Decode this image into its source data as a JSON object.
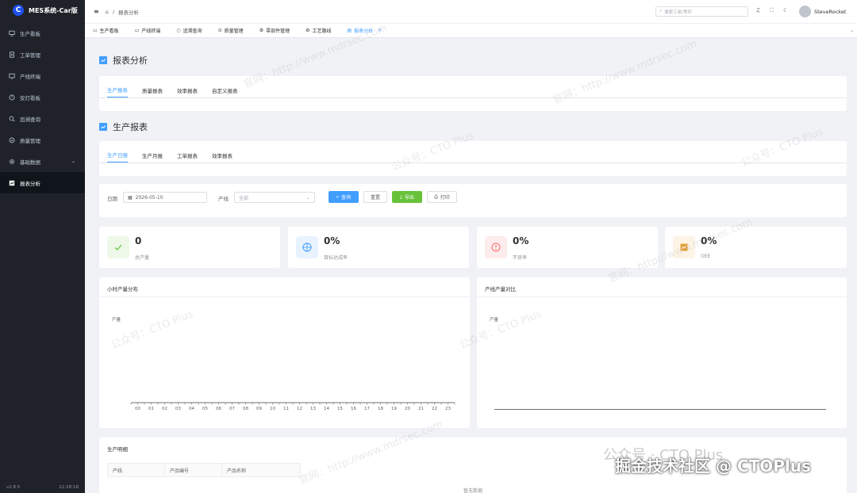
{
  "app": {
    "title": "MES系统-Car版",
    "logo_letter": "C",
    "version": "v2.8.5",
    "clock": "22:28:18"
  },
  "sidebar": {
    "items": [
      {
        "label": "生产看板",
        "icon": "monitor-icon"
      },
      {
        "label": "工单管理",
        "icon": "document-icon"
      },
      {
        "label": "产线终端",
        "icon": "terminal-icon"
      },
      {
        "label": "安灯看板",
        "icon": "alarm-icon"
      },
      {
        "label": "追溯查询",
        "icon": "search-icon"
      },
      {
        "label": "质量管理",
        "icon": "check-circle-icon"
      },
      {
        "label": "基础数据",
        "icon": "gear-icon"
      },
      {
        "label": "报表分析",
        "icon": "chart-icon"
      }
    ]
  },
  "header": {
    "breadcrumb": "报表分析",
    "search_placeholder": "搜索工单/零件",
    "user": "SteveRocket"
  },
  "tabs": [
    {
      "label": "生产看板"
    },
    {
      "label": "产线终端"
    },
    {
      "label": "追溯查询"
    },
    {
      "label": "质量管理"
    },
    {
      "label": "零部件管理"
    },
    {
      "label": "工艺路线"
    },
    {
      "label": "报表分析"
    }
  ],
  "page": {
    "title": "报表分析",
    "report_tabs": [
      "生产报表",
      "质量报表",
      "效率报表",
      "自定义报表"
    ],
    "section_title": "生产报表",
    "sub_tabs": [
      "生产日报",
      "生产月报",
      "工单报表",
      "效率报表"
    ]
  },
  "filters": {
    "date_label": "日期",
    "date_value": "2026-05-10",
    "line_label": "产线",
    "line_placeholder": "全部",
    "query": "查询",
    "reset": "重置",
    "export": "导出",
    "print": "打印"
  },
  "stats": [
    {
      "value": "0",
      "label": "总产量",
      "color": "#67c23a",
      "bg": "#eef8e8"
    },
    {
      "value": "0%",
      "label": "目标达成率",
      "color": "#409eff",
      "bg": "#e8f3ff"
    },
    {
      "value": "0%",
      "label": "不良率",
      "color": "#f56c6c",
      "bg": "#fdecec"
    },
    {
      "value": "0%",
      "label": "OEE",
      "color": "#e6a23c",
      "bg": "#fdf4e6"
    }
  ],
  "charts": {
    "hourly_title": "小时产量分布",
    "hourly_ylabel": "产量",
    "line_title": "产线产量对比",
    "line_ylabel": "产量"
  },
  "chart_data": [
    {
      "type": "bar",
      "title": "小时产量分布",
      "ylabel": "产量",
      "categories": [
        "00",
        "01",
        "02",
        "03",
        "04",
        "05",
        "06",
        "07",
        "08",
        "09",
        "10",
        "11",
        "12",
        "13",
        "14",
        "15",
        "16",
        "17",
        "18",
        "19",
        "20",
        "21",
        "22",
        "23"
      ],
      "values": []
    },
    {
      "type": "bar",
      "title": "产线产量对比",
      "ylabel": "产量",
      "categories": [],
      "values": []
    }
  ],
  "detail": {
    "title": "生产明细",
    "columns": [
      "产线",
      "产品编号",
      "产品名称"
    ],
    "empty": "暂无数据"
  },
  "watermarks": {
    "site": "官网：http://www.mdrsec.com",
    "wechat": "公众号：CTO Plus",
    "footer": "掘金技术社区 @ CTOPlus",
    "footer2": "公众号 · CTO Plus"
  }
}
